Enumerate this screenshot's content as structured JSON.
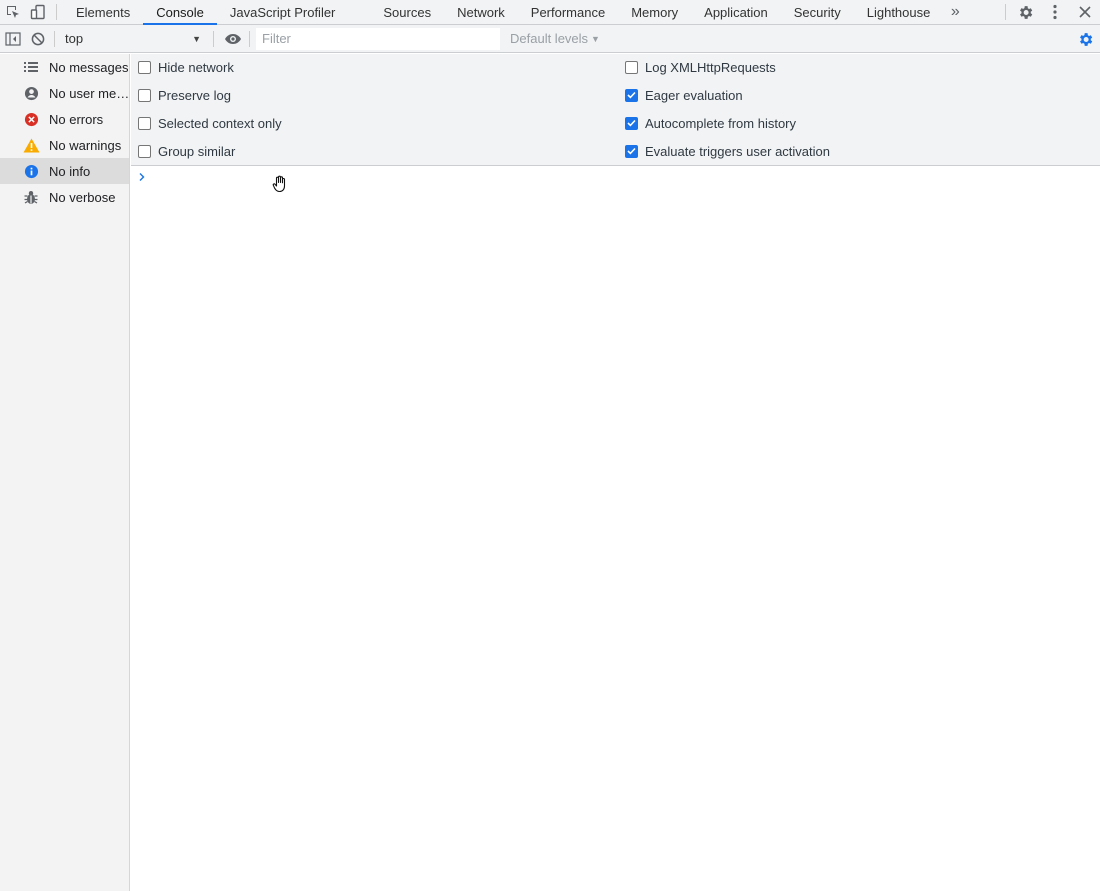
{
  "tabs": [
    {
      "label": "Elements",
      "active": false
    },
    {
      "label": "Console",
      "active": true
    },
    {
      "label": "JavaScript Profiler",
      "active": false
    },
    {
      "label": "Sources",
      "active": false
    },
    {
      "label": "Network",
      "active": false
    },
    {
      "label": "Performance",
      "active": false
    },
    {
      "label": "Memory",
      "active": false
    },
    {
      "label": "Application",
      "active": false
    },
    {
      "label": "Security",
      "active": false
    },
    {
      "label": "Lighthouse",
      "active": false
    }
  ],
  "toolbar": {
    "context": "top",
    "filter_placeholder": "Filter",
    "levels": "Default levels"
  },
  "sidebar": {
    "items": [
      {
        "label": "No messages",
        "icon": "list-icon"
      },
      {
        "label": "No user me…",
        "icon": "user-icon"
      },
      {
        "label": "No errors",
        "icon": "error-icon"
      },
      {
        "label": "No warnings",
        "icon": "warning-icon"
      },
      {
        "label": "No info",
        "icon": "info-icon",
        "selected": true
      },
      {
        "label": "No verbose",
        "icon": "bug-icon"
      }
    ]
  },
  "settings": {
    "left": [
      {
        "label": "Hide network",
        "checked": false
      },
      {
        "label": "Preserve log",
        "checked": false
      },
      {
        "label": "Selected context only",
        "checked": false
      },
      {
        "label": "Group similar",
        "checked": false
      }
    ],
    "right": [
      {
        "label": "Log XMLHttpRequests",
        "checked": false
      },
      {
        "label": "Eager evaluation",
        "checked": true
      },
      {
        "label": "Autocomplete from history",
        "checked": true
      },
      {
        "label": "Evaluate triggers user activation",
        "checked": true
      }
    ]
  },
  "colors": {
    "accent": "#1a73e8",
    "error": "#d93025",
    "warning": "#f9ab00",
    "info": "#1a73e8"
  }
}
